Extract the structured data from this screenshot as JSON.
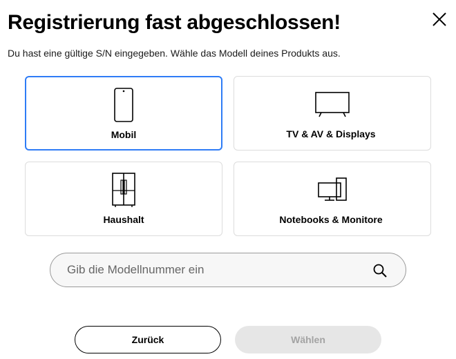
{
  "dialog": {
    "title": "Registrierung fast abgeschlossen!",
    "subtitle": "Du hast eine gültige S/N eingegeben. Wähle das Modell deines Produkts aus.",
    "close_icon": "close-icon"
  },
  "categories": [
    {
      "label": "Mobil",
      "icon": "smartphone-icon",
      "selected": true
    },
    {
      "label": "TV & AV & Displays",
      "icon": "tv-icon",
      "selected": false
    },
    {
      "label": "Haushalt",
      "icon": "refrigerator-icon",
      "selected": false
    },
    {
      "label": "Notebooks & Monitore",
      "icon": "monitor-icon",
      "selected": false
    }
  ],
  "search": {
    "placeholder": "Gib die Modellnummer ein",
    "value": "",
    "icon": "search-icon"
  },
  "buttons": {
    "back_label": "Zurück",
    "choose_label": "Wählen",
    "choose_disabled": true
  },
  "colors": {
    "selected_border": "#2e7cf6",
    "card_border": "#dcdcdc",
    "disabled_button_bg": "#e6e6e6",
    "disabled_button_text": "#a3a3a3"
  }
}
